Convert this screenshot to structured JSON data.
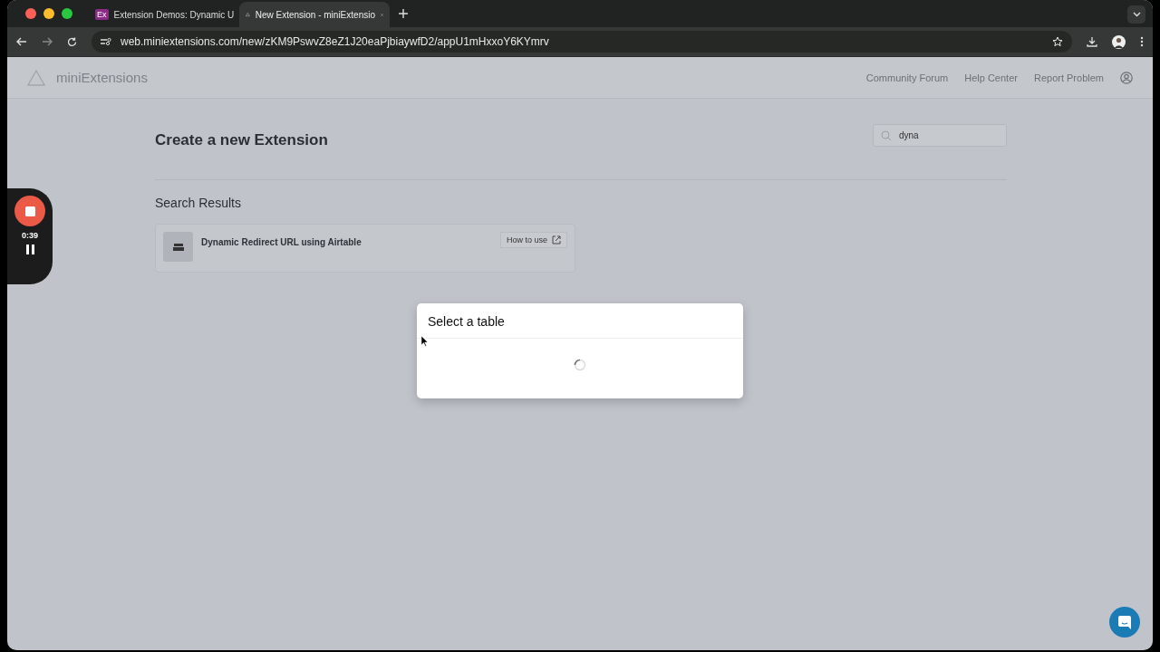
{
  "browser": {
    "tabs": [
      {
        "title": "Extension Demos: Dynamic U",
        "selected": false,
        "kind": "app"
      },
      {
        "title": "New Extension - miniExtensio",
        "selected": true,
        "kind": "triangle"
      }
    ],
    "url": "web.miniextensions.com/new/zKM9PswvZ8eZ1J20eaPjbiaywfD2/appU1mHxxoY6KYmrv",
    "favicon_text": "Ex"
  },
  "header": {
    "brand": "miniExtensions",
    "links": [
      "Community Forum",
      "Help Center",
      "Report Problem"
    ]
  },
  "page": {
    "title": "Create a new Extension",
    "search": {
      "value": "dyna"
    },
    "results_heading": "Search Results",
    "results": [
      {
        "name": "Dynamic Redirect URL using Airtable",
        "action": "How to use"
      }
    ]
  },
  "modal": {
    "title": "Select a table",
    "loading": true
  },
  "recorder": {
    "time": "0:39"
  }
}
